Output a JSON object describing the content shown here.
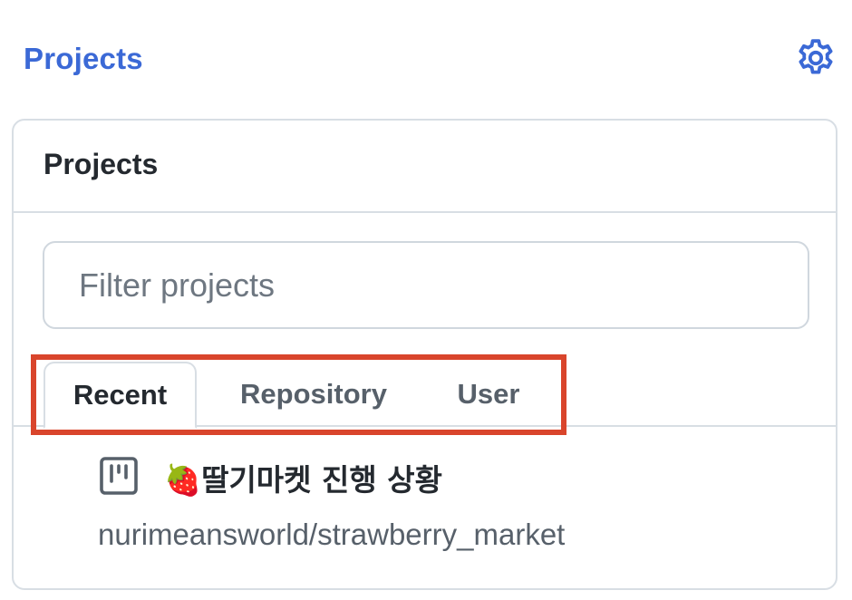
{
  "header": {
    "title": "Projects",
    "settings_icon": "gear-icon"
  },
  "panel": {
    "title": "Projects",
    "filter": {
      "placeholder": "Filter projects",
      "value": ""
    },
    "tabs": [
      {
        "label": "Recent",
        "selected": true
      },
      {
        "label": "Repository",
        "selected": false
      },
      {
        "label": "User",
        "selected": false
      }
    ],
    "projects": [
      {
        "icon": "project-board-icon",
        "name": "🍓딸기마켓 진행 상황",
        "repo": "nurimeansworld/strawberry_market"
      }
    ]
  },
  "colors": {
    "accent": "#3b69d6",
    "highlight": "#d9452c",
    "border": "#d8dee4"
  }
}
